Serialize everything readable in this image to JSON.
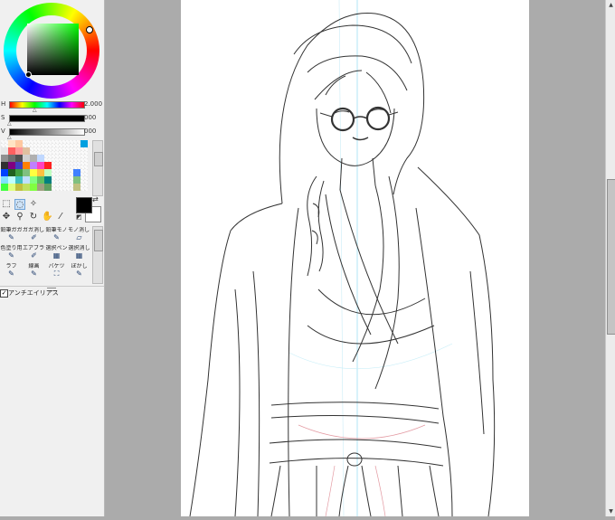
{
  "color_panel": {
    "hue": {
      "label": "H",
      "value": "2.000",
      "level": 0.33
    },
    "saturation": {
      "label": "S",
      "value": "000",
      "level": 0.0
    },
    "value": {
      "label": "V",
      "value": "000",
      "level": 0.0
    },
    "colors": {
      "hue_color": "#00ff00",
      "foreground": "#000000",
      "background": "#ffffff"
    }
  },
  "swatches": [
    "#ffffff",
    "#ffe4c4",
    "#ffc8a0",
    "#ffffff",
    "#ffffff",
    "#ffffff",
    "#ffffff",
    "#ffffff",
    "#ffffff",
    "#ffffff",
    "#ffffff",
    "#00a0e0",
    "#e8e8e8",
    "#ff6060",
    "#ff9999",
    "#e0c0a0",
    "#ffffff",
    "#ffffff",
    "#ffffff",
    "#ffffff",
    "#ffffff",
    "#ffffff",
    "#ffffff",
    "#ffffff",
    "#909090",
    "#707070",
    "#505050",
    "#d0d0d0",
    "#b0b0b0",
    "#c0d8ff",
    "#ffffff",
    "#ffffff",
    "#ffffff",
    "#ffffff",
    "#ffffff",
    "#ffffff",
    "#303030",
    "#800080",
    "#4040c0",
    "#ff8000",
    "#c080ff",
    "#ff40c0",
    "#ff2020",
    "#ffffff",
    "#ffffff",
    "#ffffff",
    "#ffffff",
    "#ffffff",
    "#0040ff",
    "#206020",
    "#40a040",
    "#80c080",
    "#ffff40",
    "#ffc040",
    "#c0ffc0",
    "#ffffff",
    "#ffffff",
    "#ffffff",
    "#4080ff",
    "#ffffff",
    "#80e0ff",
    "#c0ffff",
    "#40c0c0",
    "#c0e0ff",
    "#80ff80",
    "#60c060",
    "#008080",
    "#ffffff",
    "#ffffff",
    "#ffffff",
    "#80c080",
    "#ffffff",
    "#40ff40",
    "#e0ff80",
    "#c0c040",
    "#c0e060",
    "#80ff40",
    "#a0a080",
    "#60a060",
    "#ffffff",
    "#ffffff",
    "#ffffff",
    "#c0c080",
    "#ffffff"
  ],
  "tools": {
    "row1": [
      {
        "name": "rect-select-icon",
        "glyph": "⬚",
        "active": false
      },
      {
        "name": "lasso-select-icon",
        "glyph": "◌",
        "active": true
      },
      {
        "name": "magic-wand-icon",
        "glyph": "✧",
        "active": false
      }
    ],
    "row2": [
      {
        "name": "move-icon",
        "glyph": "✥",
        "active": false
      },
      {
        "name": "zoom-icon",
        "glyph": "⚲",
        "active": false
      },
      {
        "name": "rotate-icon",
        "glyph": "↻",
        "active": false
      },
      {
        "name": "hand-icon",
        "glyph": "✋",
        "active": false
      },
      {
        "name": "eyedropper-icon",
        "glyph": "⁄",
        "active": false
      }
    ],
    "swap_glyph": "⇄",
    "reset_glyph": "◩"
  },
  "brushes": [
    {
      "label": "鉛筆ガガ",
      "glyph": "✎"
    },
    {
      "label": "ガガ消しご",
      "glyph": "✐"
    },
    {
      "label": "鉛筆モノ",
      "glyph": "✎"
    },
    {
      "label": "モノ消しご",
      "glyph": "▱"
    },
    {
      "label": "色塗り用",
      "glyph": "✎"
    },
    {
      "label": "エアブラシ",
      "glyph": "✐"
    },
    {
      "label": "選択ペン",
      "glyph": "▦"
    },
    {
      "label": "選択消し",
      "glyph": "▦"
    },
    {
      "label": "ラフ",
      "glyph": "✎"
    },
    {
      "label": "線画",
      "glyph": "✎"
    },
    {
      "label": "バケツ",
      "glyph": "⛶"
    },
    {
      "label": "ぼかし",
      "glyph": "✎"
    }
  ],
  "antialias": {
    "label": "アンチエイリアス",
    "checked": true,
    "check_glyph": "✓"
  },
  "scrollbar": {
    "up_glyph": "▲",
    "down_glyph": "▼"
  }
}
